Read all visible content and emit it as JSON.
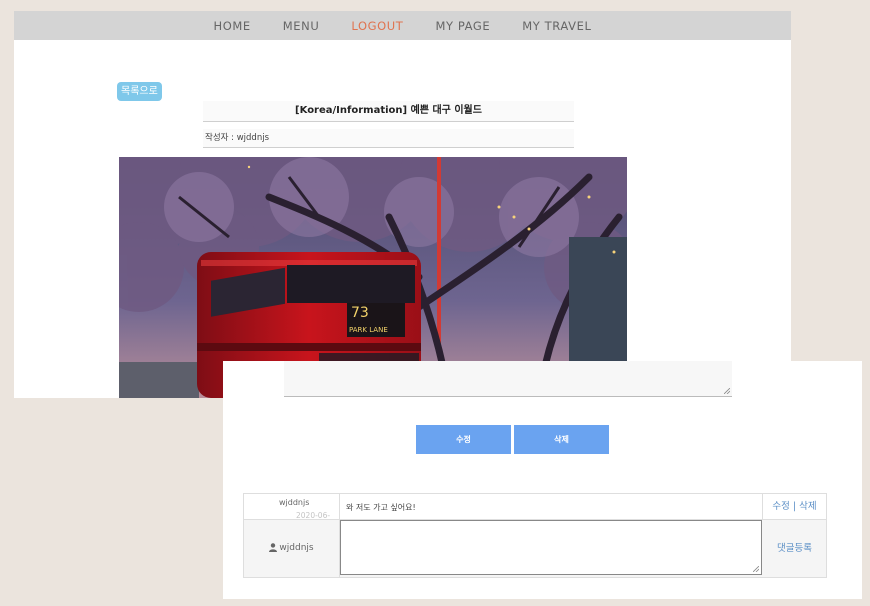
{
  "nav": {
    "items": [
      {
        "label": "HOME"
      },
      {
        "label": "MENU"
      },
      {
        "label": "LOGOUT"
      },
      {
        "label": "MY PAGE"
      },
      {
        "label": "MY TRAVEL"
      }
    ],
    "active_color": "#e0734f"
  },
  "post": {
    "back_label": "목록으로",
    "title": "[Korea/Information] 예쁜 대구 이월드",
    "author_line": "작성자 : wjddnjs",
    "photo": {
      "bus_number": "73",
      "bus_sign": "PARK LANE"
    }
  },
  "actions": {
    "edit_label": "수정",
    "delete_label": "삭제"
  },
  "comments": {
    "items": [
      {
        "user": "wjddnjs",
        "date": "2020-06-27",
        "text": "와 저도 가고 싶어요!",
        "edit_label": "수정",
        "separator": "|",
        "delete_label": "삭제"
      }
    ],
    "new_comment_user": "wjddnjs",
    "submit_label": "댓글등록"
  },
  "colors": {
    "background": "#ebe4dd",
    "nav_bar": "#d4d4d4",
    "button_blue": "#6aa3f0",
    "back_button": "#7fc8ea",
    "link_blue": "#5b8fc6"
  }
}
